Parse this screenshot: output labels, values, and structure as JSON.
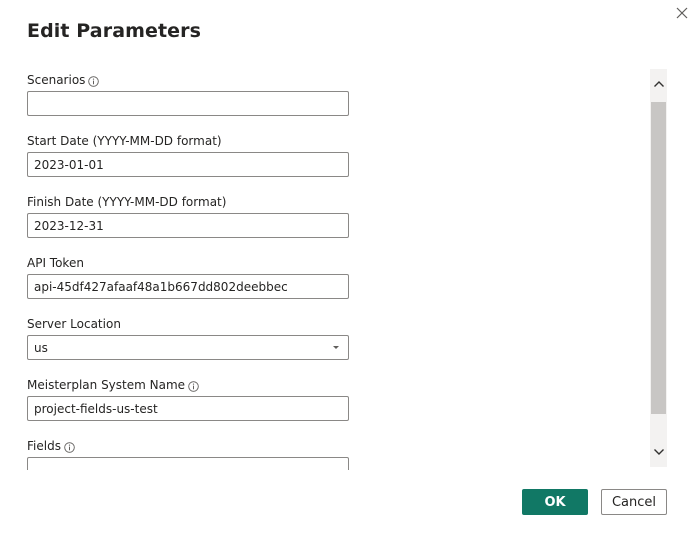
{
  "dialog": {
    "title": "Edit Parameters",
    "ok_label": "OK",
    "cancel_label": "Cancel"
  },
  "fields": [
    {
      "label": "Scenarios",
      "value": "",
      "has_info": true
    },
    {
      "label": "Start Date (YYYY-MM-DD format)",
      "value": "2023-01-01",
      "has_info": false
    },
    {
      "label": "Finish Date (YYYY-MM-DD format)",
      "value": "2023-12-31",
      "has_info": false
    },
    {
      "label": "API Token",
      "value": "api-45df427afaaf48a1b667dd802deebbec",
      "has_info": false
    },
    {
      "label": "Server Location",
      "value": "us",
      "has_info": false,
      "type": "dropdown"
    },
    {
      "label": "Meisterplan System Name",
      "value": "project-fields-us-test",
      "has_info": true
    },
    {
      "label": "Fields",
      "value": "",
      "has_info": true
    }
  ],
  "colors": {
    "accent": "#117865",
    "border": "#8a8886",
    "scroll_thumb": "#c8c6c4"
  }
}
